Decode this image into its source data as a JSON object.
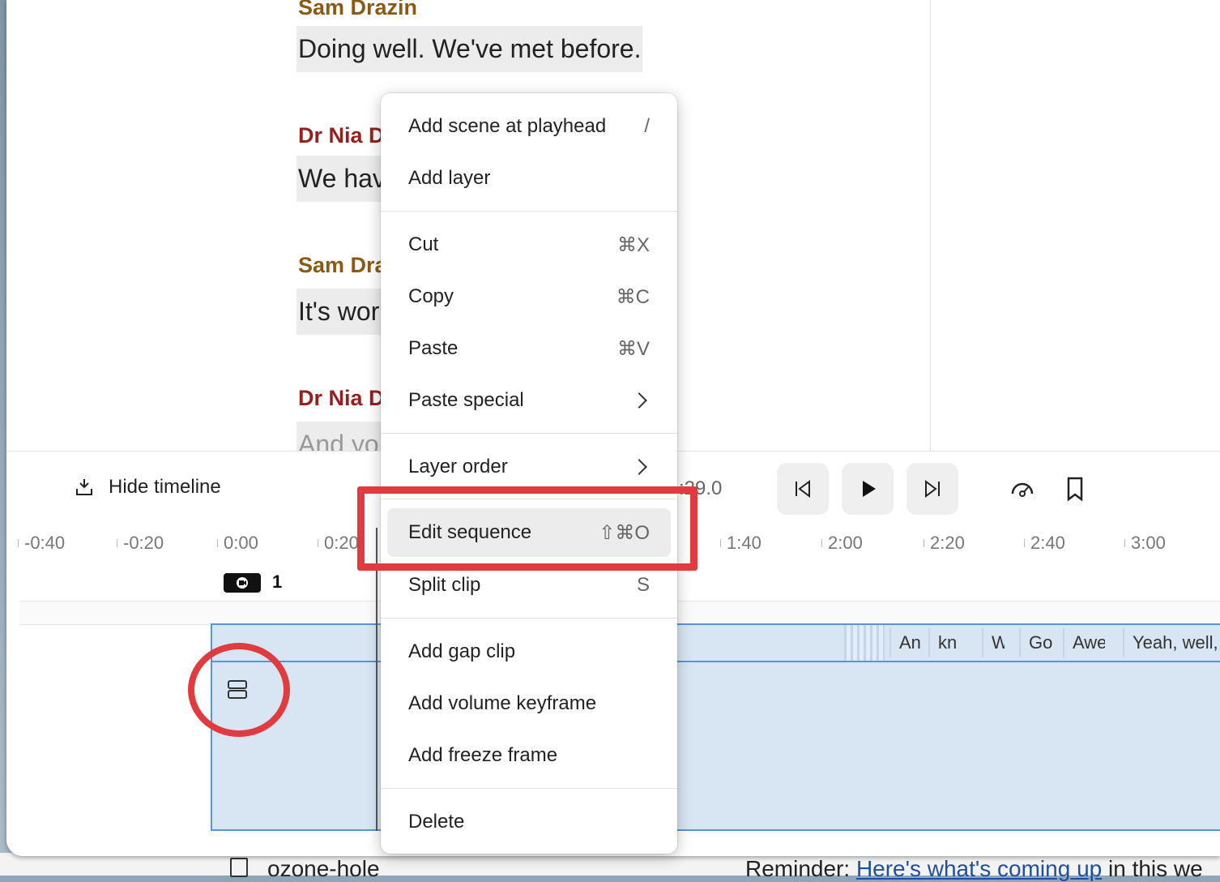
{
  "script": {
    "entries": [
      {
        "speaker": "Sam Drazin",
        "text": "Doing well. We've met before."
      },
      {
        "speaker": "Dr Nia D",
        "text": "We hav"
      },
      {
        "speaker": "Sam Dra",
        "text": "It's wor"
      },
      {
        "speaker": "Dr Nia D",
        "text": "And yo                        intending"
      }
    ]
  },
  "timeline": {
    "hide_label": "Hide timeline",
    "timecode": ":29.0",
    "ruler": [
      "-0:40",
      "-0:20",
      "0:00",
      "0:20",
      "1:40",
      "2:00",
      "2:20",
      "2:40",
      "3:00"
    ],
    "scene_number": "1",
    "word_chips": [
      "An",
      "kn",
      "W",
      "Go",
      "Awe",
      "Yeah, well,"
    ]
  },
  "context_menu": {
    "items": [
      {
        "label": "Add scene at playhead",
        "shortcut": "/"
      },
      {
        "label": "Add layer",
        "shortcut": ""
      },
      {
        "label": "Cut",
        "shortcut": "⌘X"
      },
      {
        "label": "Copy",
        "shortcut": "⌘C"
      },
      {
        "label": "Paste",
        "shortcut": "⌘V"
      },
      {
        "label": "Paste special",
        "shortcut": ""
      },
      {
        "label": "Layer order",
        "shortcut": ""
      },
      {
        "label": "Edit sequence",
        "shortcut": "⇧⌘O"
      },
      {
        "label": "Split clip",
        "shortcut": "S"
      },
      {
        "label": "Add gap clip",
        "shortcut": ""
      },
      {
        "label": "Add volume keyframe",
        "shortcut": ""
      },
      {
        "label": "Add freeze frame",
        "shortcut": ""
      },
      {
        "label": "Delete",
        "shortcut": ""
      }
    ]
  },
  "background": {
    "ozone": "ozone-hole",
    "reminder_prefix": "Reminder: ",
    "reminder_link": "Here's what's coming up",
    "reminder_suffix": " in this we"
  },
  "colors": {
    "highlight": "#e03c3f",
    "selection": "#5b93d8",
    "sam": "#8b5a12",
    "nia": "#961f1f"
  }
}
